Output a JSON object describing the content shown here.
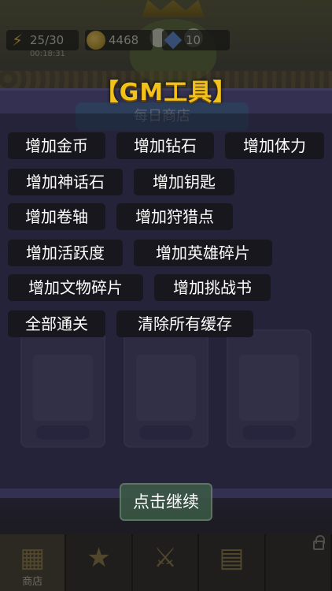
{
  "status": {
    "energy": "25/30",
    "energy_timer": "00:18:31",
    "coins": "4468",
    "gems": "10"
  },
  "dialog": {
    "title": "【GM工具】",
    "buttons": [
      "增加金币",
      "增加钻石",
      "增加体力",
      "增加神话石",
      "增加钥匙",
      "增加卷轴",
      "增加狩猎点",
      "增加活跃度",
      "增加英雄碎片",
      "增加文物碎片",
      "增加挑战书",
      "全部通关",
      "清除所有缓存"
    ],
    "continue_label": "点击继续"
  },
  "background": {
    "shop_title": "每日商店",
    "bottom_tabs": [
      "商店",
      "",
      "",
      "",
      ""
    ]
  },
  "colors": {
    "title_gold": "#f3c21a",
    "button_bg": "#17171d",
    "panel_purple": "#57518a"
  }
}
